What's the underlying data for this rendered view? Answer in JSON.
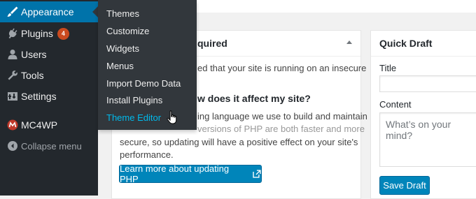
{
  "sidebar": {
    "items": [
      {
        "label": "Appearance",
        "icon": "paintbrush-icon"
      },
      {
        "label": "Plugins",
        "icon": "plugin-icon",
        "badge": "4"
      },
      {
        "label": "Users",
        "icon": "users-icon"
      },
      {
        "label": "Tools",
        "icon": "wrench-icon"
      },
      {
        "label": "Settings",
        "icon": "settings-icon"
      },
      {
        "label": "MC4WP",
        "icon": "mc4wp-icon"
      },
      {
        "label": "Collapse menu",
        "icon": "collapse-icon"
      }
    ]
  },
  "flyout": {
    "items": [
      "Themes",
      "Customize",
      "Widgets",
      "Menus",
      "Import Demo Data",
      "Install Plugins",
      "Theme Editor"
    ]
  },
  "php_panel": {
    "title_visible": "quired",
    "line1": "ed that your site is running on an insecure",
    "heading": "w does it affect my site?",
    "line2": "ing language we use to build and maintain",
    "line3": "secure, so updating will have a positive effect on your site's",
    "line4": "performance.",
    "line_partial": "versions of PHP are both faster and more",
    "button": "Learn more about updating PHP"
  },
  "quick_draft": {
    "title": "Quick Draft",
    "title_label": "Title",
    "content_label": "Content",
    "content_placeholder": "What’s on your mind?",
    "save_button": "Save Draft"
  },
  "colors": {
    "sidebar_bg": "#23282d",
    "accent": "#0073aa",
    "button": "#0085ba",
    "badge": "#ca4a1f",
    "current_submenu": "#00b9eb"
  }
}
